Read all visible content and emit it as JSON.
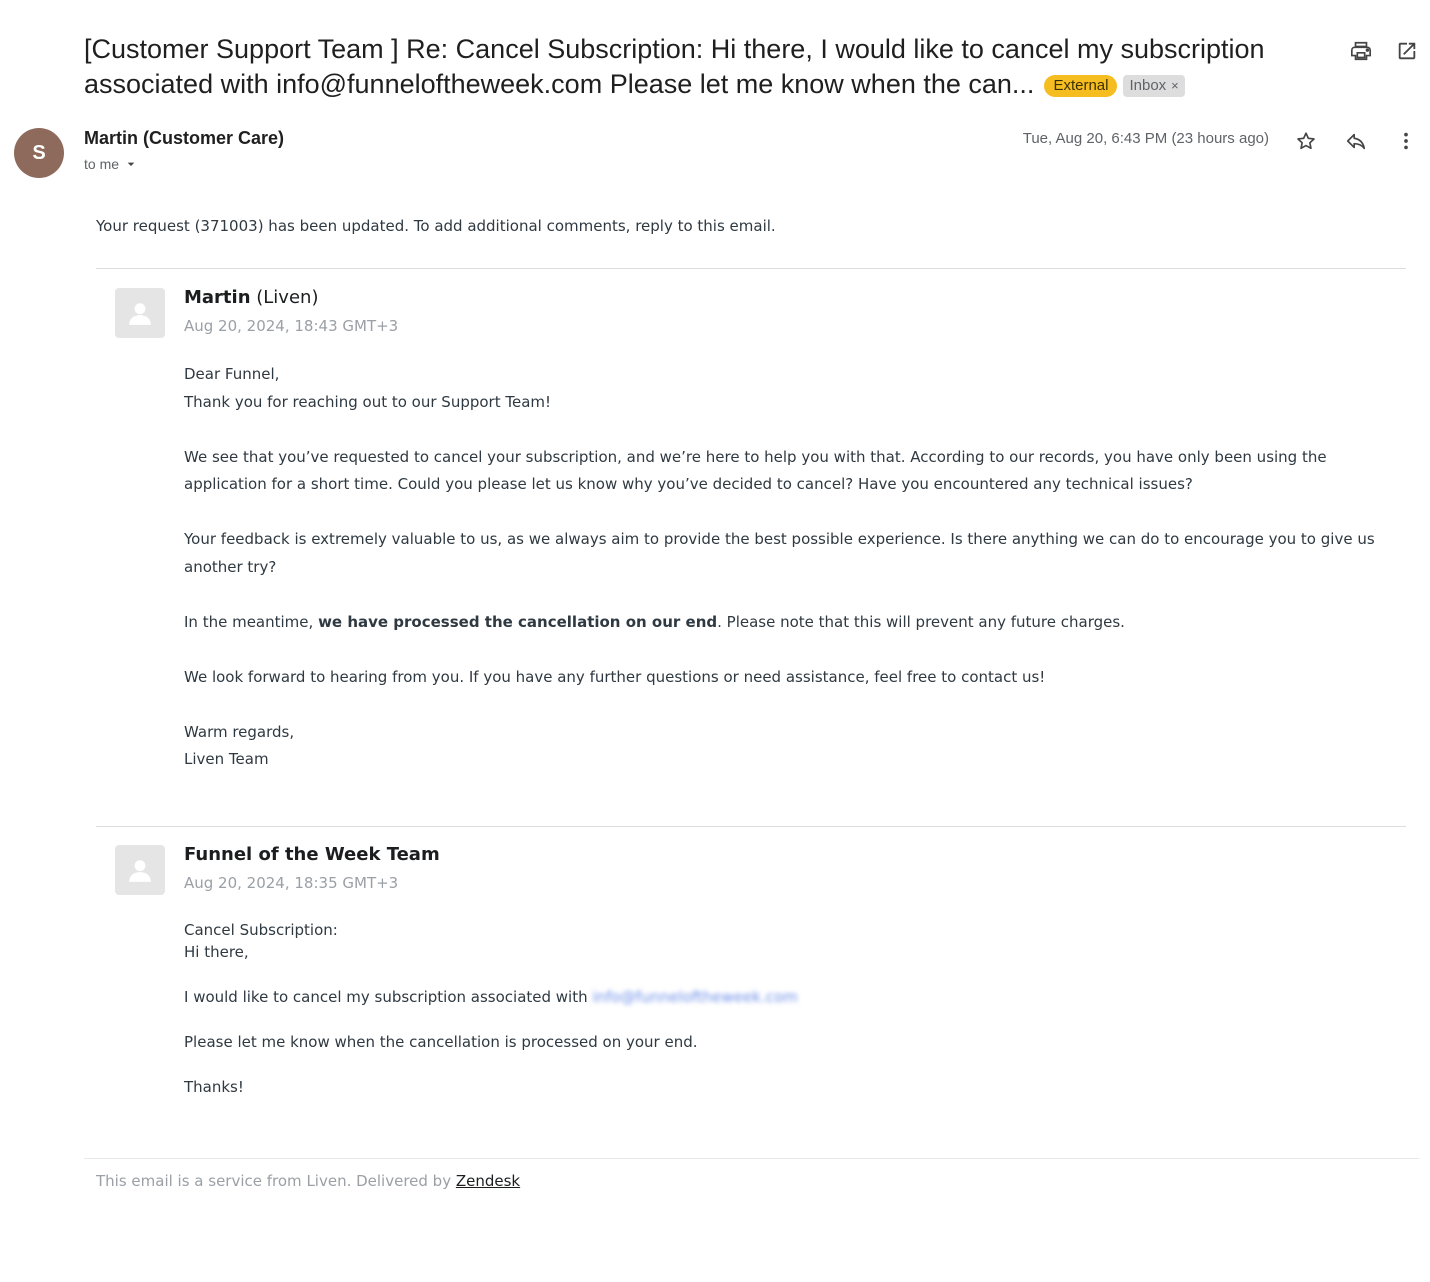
{
  "subject": {
    "line1": "[Customer Support Team ] Re: Cancel Subscription: Hi there, I would like to cancel my subscription",
    "line2": "associated with info@funneloftheweek.com Please let me know when the can...",
    "tag_external": "External",
    "tag_inbox": "Inbox",
    "tag_inbox_close": "×"
  },
  "header": {
    "avatar_letter": "S",
    "sender": "Martin (Customer Care)",
    "to": "to me",
    "date": "Tue, Aug 20, 6:43 PM (23 hours ago)"
  },
  "intro": "Your request (371003) has been updated. To add additional comments, reply to this email.",
  "message1": {
    "author_name": "Martin",
    "author_org": " (Liven)",
    "date": "Aug 20, 2024, 18:43 GMT+3",
    "greeting": "Dear Funnel,",
    "thanks": "Thank you for reaching out to our Support Team!",
    "para1": "We see that you’ve requested to cancel your subscription, and we’re here to help you with that. According to our records, you have only been using the application for a short time. Could you please let us know why you’ve decided to cancel? Have you encountered any technical issues?",
    "para2": "Your feedback is extremely valuable to us, as we always aim to provide the best possible experience. Is there anything we can do to encourage you to give us another try?",
    "para3_a": "In the meantime, ",
    "para3_bold": "we have processed the cancellation on our end",
    "para3_b": ". Please note that this will prevent any future charges.",
    "para4": "We look forward to hearing from you. If you have any further questions or need assistance, feel free to contact us!",
    "signoff": "Warm regards,",
    "signature": "Liven Team"
  },
  "message2": {
    "author": "Funnel of the Week Team",
    "date": "Aug 20, 2024, 18:35 GMT+3",
    "line1": "Cancel Subscription:",
    "line2": "Hi there,",
    "line3": "I would like to cancel my subscription associated with ",
    "email_blurred": "info@funneloftheweek.com",
    "line4": "Please let me know when the cancellation is processed on your end.",
    "line5": "Thanks!"
  },
  "footer": {
    "text": "This email is a service from Liven. Delivered by ",
    "link": "Zendesk"
  },
  "icons": [
    "print-icon",
    "open-in-new-window-icon",
    "star-icon",
    "reply-icon",
    "more-vert-icon",
    "dropdown-arrow-icon",
    "person-placeholder-icon"
  ]
}
